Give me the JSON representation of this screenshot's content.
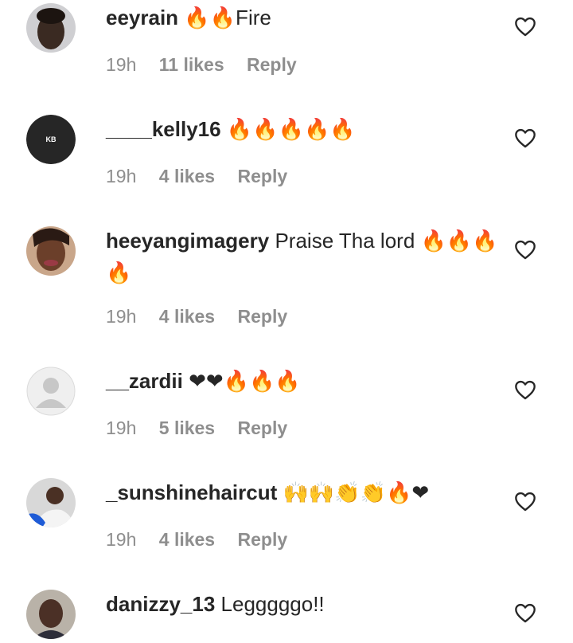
{
  "comments": [
    {
      "username": "eeyrain",
      "text": "🔥🔥Fire",
      "time": "19h",
      "likes": "11 likes",
      "reply": "Reply",
      "avatar": "photo-avatar"
    },
    {
      "username": "____kelly16",
      "text": "🔥🔥🔥🔥🔥",
      "time": "19h",
      "likes": "4 likes",
      "reply": "Reply",
      "avatar": "initials-avatar",
      "avatar_initials": "KB"
    },
    {
      "username": "heeyangimagery",
      "text": "Praise Tha lord 🔥🔥🔥🔥",
      "time": "19h",
      "likes": "4 likes",
      "reply": "Reply",
      "avatar": "photo-avatar"
    },
    {
      "username": "__zardii",
      "text": "❤❤🔥🔥🔥",
      "time": "19h",
      "likes": "5 likes",
      "reply": "Reply",
      "avatar": "default-avatar"
    },
    {
      "username": "_sunshinehaircut",
      "text": "🙌🙌👏👏🔥❤",
      "time": "19h",
      "likes": "4 likes",
      "reply": "Reply",
      "avatar": "photo-avatar"
    },
    {
      "username": "danizzy_13",
      "text": "Legggggo!!",
      "avatar": "photo-avatar"
    }
  ],
  "icons": {
    "like": "heart-outline-icon"
  },
  "colors": {
    "text": "#262626",
    "meta": "#8e8e8e",
    "fire": "#f97316",
    "heart_red": "#e0245e"
  }
}
